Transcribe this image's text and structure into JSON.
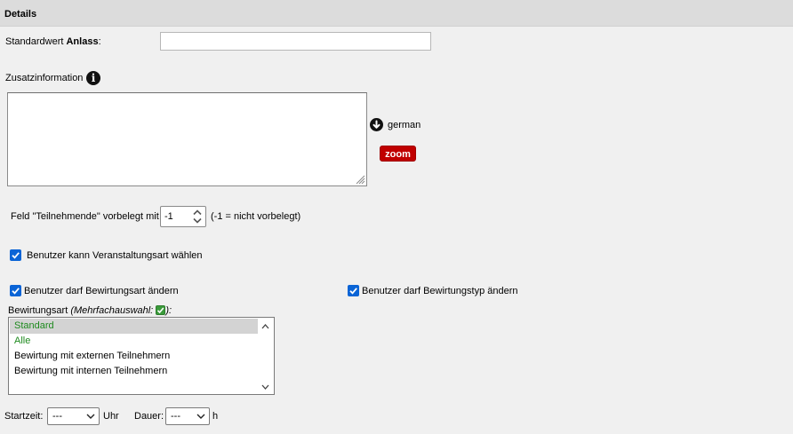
{
  "section": {
    "title": "Details"
  },
  "anlass": {
    "label_prefix": "Standardwert ",
    "label_bold": "Anlass",
    "label_suffix": ":",
    "value": ""
  },
  "zusatz": {
    "label": "Zusatzinformation",
    "info_icon": "info-icon",
    "value": "",
    "language": "german",
    "language_icon": "arrow-down-circle-icon",
    "zoom_label": "zoom"
  },
  "teilnehmende": {
    "label": "Feld \"Teilnehmende\" vorbelegt mit",
    "value": "-1",
    "hint": "(-1 = nicht vorbelegt)"
  },
  "checkboxes": {
    "veranstaltungsart": {
      "label": "Benutzer kann Veranstaltungsart wählen",
      "checked": true
    },
    "bewirtungsart": {
      "label": "Benutzer darf Bewirtungsart ändern",
      "checked": true
    },
    "bewirtungstyp": {
      "label": "Benutzer darf Bewirtungstyp ändern",
      "checked": true
    }
  },
  "bewirtungsart": {
    "label": "Bewirtungsart ",
    "multi_label": "(Mehrfachauswahl: ",
    "multi_suffix": "):",
    "multi_checked": true,
    "options": [
      {
        "label": "Standard",
        "selected": true,
        "color": "#1e8a1e"
      },
      {
        "label": "Alle",
        "selected": false,
        "color": "#1e8a1e"
      },
      {
        "label": "Bewirtung mit externen Teilnehmern",
        "selected": false,
        "color": "#000000"
      },
      {
        "label": "Bewirtung mit internen Teilnehmern",
        "selected": false,
        "color": "#000000"
      }
    ]
  },
  "time": {
    "start_label": "Startzeit:",
    "start_value": "---",
    "start_unit": "Uhr",
    "duration_label": "Dauer:",
    "duration_value": "---",
    "duration_unit": "h"
  },
  "colors": {
    "header_bg": "#dcdcdc",
    "zoom_button": "#c00000",
    "checkbox_accent": "#0a64d6",
    "list_option_green": "#1e8a1e"
  }
}
